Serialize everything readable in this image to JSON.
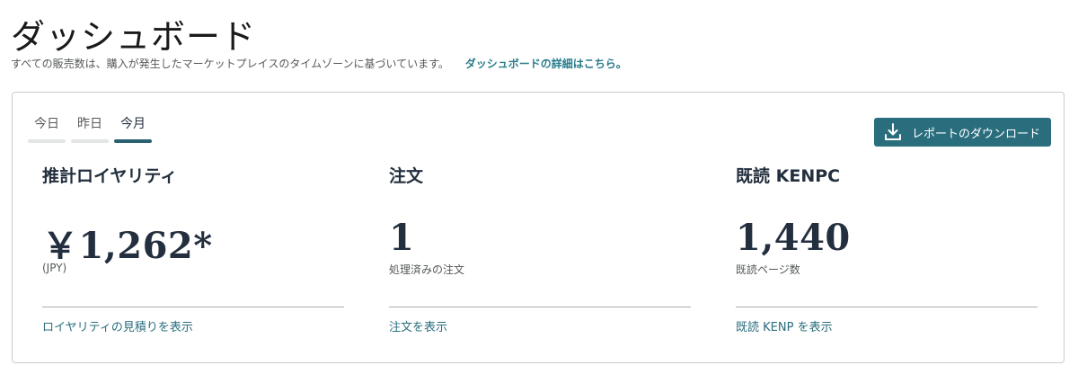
{
  "header": {
    "title": "ダッシュボード",
    "subtitle": "すべての販売数は、購入が発生したマーケットプレイスのタイムゾーンに基づいています。",
    "details_link": "ダッシュボードの詳細はこちら。"
  },
  "tabs": [
    {
      "label": "今日",
      "active": false
    },
    {
      "label": "昨日",
      "active": false
    },
    {
      "label": "今月",
      "active": true
    }
  ],
  "toolbar": {
    "download_label": "レポートのダウンロード",
    "download_icon": "download-icon"
  },
  "metrics": [
    {
      "title": "推計ロイヤリティ",
      "value": "￥1,262*",
      "caption": "(JPY)",
      "link": "ロイヤリティの見積りを表示"
    },
    {
      "title": "注文",
      "value": "1",
      "caption": "処理済みの注文",
      "link": "注文を表示"
    },
    {
      "title": "既読 KENPC",
      "value": "1,440",
      "caption": "既読ページ数",
      "link": "既読 KENP を表示"
    }
  ],
  "colors": {
    "accent": "#2a6e7e",
    "active_tab_bar": "#2a6172",
    "link": "#2a6e7e",
    "text_primary": "#232f3e",
    "text_secondary": "#565959",
    "border": "#c8ccd0"
  }
}
